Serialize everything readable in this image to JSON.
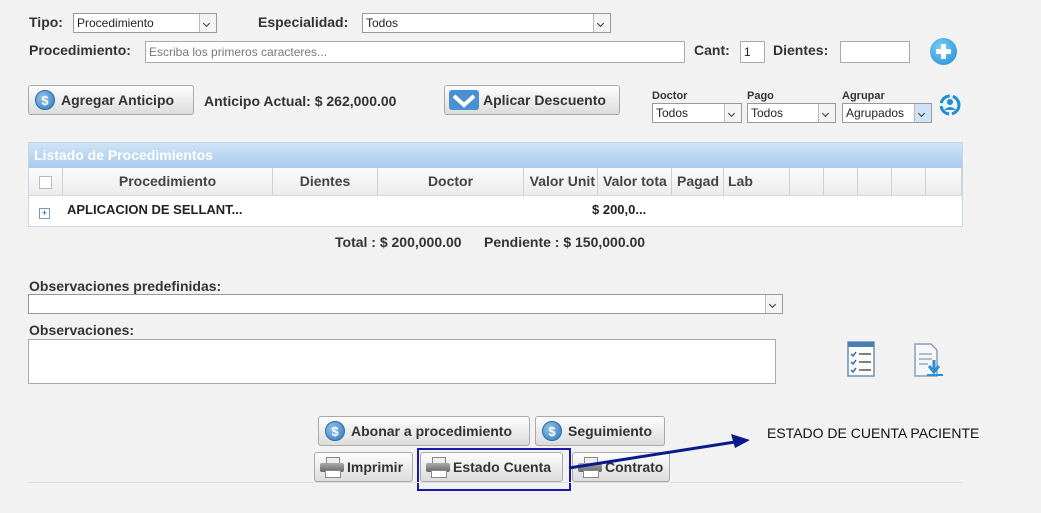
{
  "filters": {
    "tipo_label": "Tipo:",
    "tipo_value": "Procedimiento",
    "especialidad_label": "Especialidad:",
    "especialidad_value": "Todos",
    "procedimiento_label": "Procedimiento:",
    "procedimiento_placeholder": "Escriba los primeros caracteres...",
    "cant_label": "Cant:",
    "cant_value": "1",
    "dientes_label": "Dientes:",
    "dientes_value": ""
  },
  "actions": {
    "agregar_anticipo": "Agregar Anticipo",
    "anticipo_actual": "Anticipo Actual: $ 262,000.00",
    "aplicar_descuento": "Aplicar Descuento"
  },
  "grouping": {
    "doctor_label": "Doctor",
    "doctor_value": "Todos",
    "pago_label": "Pago",
    "pago_value": "Todos",
    "agrupar_label": "Agrupar",
    "agrupar_value": "Agrupados"
  },
  "table": {
    "caption": "Listado de Procedimientos",
    "columns": [
      "Procedimiento",
      "Dientes",
      "Doctor",
      "Valor Unit",
      "Valor tota",
      "Pagad",
      "Lab"
    ],
    "rows": [
      {
        "expand": "+",
        "procedimiento": "APLICACION DE SELLANT...",
        "valor_total": "$ 200,0..."
      }
    ]
  },
  "totals": {
    "total": "Total : $ 200,000.00",
    "pendiente": "Pendiente : $ 150,000.00"
  },
  "observaciones": {
    "predef_label": "Observaciones predefinidas:",
    "predef_value": "",
    "label": "Observaciones:",
    "value": ""
  },
  "buttons": {
    "abonar": "Abonar a procedimiento",
    "seguimiento": "Seguimiento",
    "imprimir": "Imprimir",
    "estado_cuenta": "Estado Cuenta",
    "contrato": "Contrato"
  },
  "annotation": {
    "text": "ESTADO DE CUENTA PACIENTE",
    "color": "#0a1a8c"
  },
  "colors": {
    "header_blue": "#b7d5f0",
    "highlight_border": "#1a1aa8"
  }
}
